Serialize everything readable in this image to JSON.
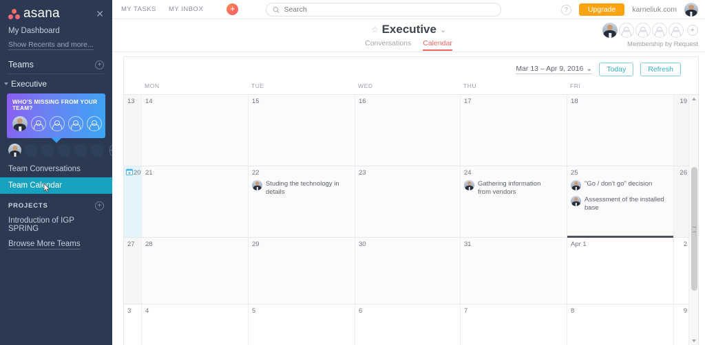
{
  "sidebar": {
    "brand": "asana",
    "close_label": "✕",
    "dashboard_label": "My Dashboard",
    "show_recents_label": "Show Recents and more...",
    "teams_label": "Teams",
    "teams_add_label": "+",
    "team_name": "Executive",
    "tooltip": {
      "title": "WHO'S MISSING FROM YOUR TEAM?",
      "ghost_count": 4
    },
    "member_dots": 5,
    "member_add_label": "+",
    "nav": [
      {
        "label": "Team Conversations",
        "active": false
      },
      {
        "label": "Team Calendar",
        "active": true
      }
    ],
    "projects_label": "PROJECTS",
    "projects_add_label": "+",
    "projects": [
      {
        "label": "Introduction of IGP SPRING"
      }
    ],
    "browse_more_label": "Browse More Teams"
  },
  "topbar": {
    "nav": [
      {
        "label": "MY TASKS"
      },
      {
        "label": "MY INBOX"
      }
    ],
    "add_label": "+",
    "search_placeholder": "Search",
    "search_value": "",
    "help_label": "?",
    "upgrade_label": "Upgrade",
    "domain": "karneliuk.com"
  },
  "project": {
    "star_glyph": "☆",
    "name": "Executive",
    "chevron_glyph": "⌄",
    "tabs": [
      {
        "label": "Conversations",
        "active": false
      },
      {
        "label": "Calendar",
        "active": true
      }
    ],
    "ghost_members": 4,
    "add_member_label": "+",
    "membership_note": "Membership by Request"
  },
  "calendar": {
    "range_label": "Mar 13 – Apr 9, 2016",
    "range_chevron": "⌄",
    "today_label": "Today",
    "refresh_label": "Refresh",
    "day_headers": [
      "MON",
      "TUE",
      "WED",
      "THU",
      "FRI"
    ],
    "weeks": [
      {
        "days": [
          {
            "num": "13",
            "type": "weekend-left"
          },
          {
            "num": "14",
            "type": "weekday"
          },
          {
            "num": "15",
            "type": "weekday"
          },
          {
            "num": "16",
            "type": "weekday"
          },
          {
            "num": "17",
            "type": "weekday"
          },
          {
            "num": "18",
            "type": "weekday"
          },
          {
            "num": "19",
            "type": "weekend-right"
          }
        ],
        "tasks": []
      },
      {
        "days": [
          {
            "num": "20",
            "type": "today"
          },
          {
            "num": "21",
            "type": "weekday"
          },
          {
            "num": "22",
            "type": "weekday"
          },
          {
            "num": "23",
            "type": "weekday"
          },
          {
            "num": "24",
            "type": "weekday"
          },
          {
            "num": "25",
            "type": "weekday"
          },
          {
            "num": "26",
            "type": "weekend-right"
          }
        ],
        "tasks": [
          {
            "day_index": 2,
            "row": 0,
            "text": "Studing the technology in details"
          },
          {
            "day_index": 4,
            "row": 0,
            "text": "Gathering information from vendors"
          },
          {
            "day_index": 5,
            "row": 0,
            "text": "\"Go / don't go\" decision"
          },
          {
            "day_index": 5,
            "row": 1,
            "text": "Assessment of the installed base"
          }
        ]
      },
      {
        "days": [
          {
            "num": "27",
            "type": "weekend-left"
          },
          {
            "num": "28",
            "type": "weekday"
          },
          {
            "num": "29",
            "type": "weekday"
          },
          {
            "num": "30",
            "type": "weekday"
          },
          {
            "num": "31",
            "type": "weekday"
          },
          {
            "num": "Apr 1",
            "type": "month-start"
          },
          {
            "num": "2",
            "type": "weekend-right"
          }
        ],
        "tasks": []
      },
      {
        "days": [
          {
            "num": "3",
            "type": "weekend-left"
          },
          {
            "num": "4",
            "type": "weekday"
          },
          {
            "num": "5",
            "type": "weekday"
          },
          {
            "num": "6",
            "type": "weekday"
          },
          {
            "num": "7",
            "type": "weekday"
          },
          {
            "num": "8",
            "type": "weekday"
          },
          {
            "num": "9",
            "type": "weekend-right"
          }
        ],
        "tasks": []
      }
    ]
  }
}
